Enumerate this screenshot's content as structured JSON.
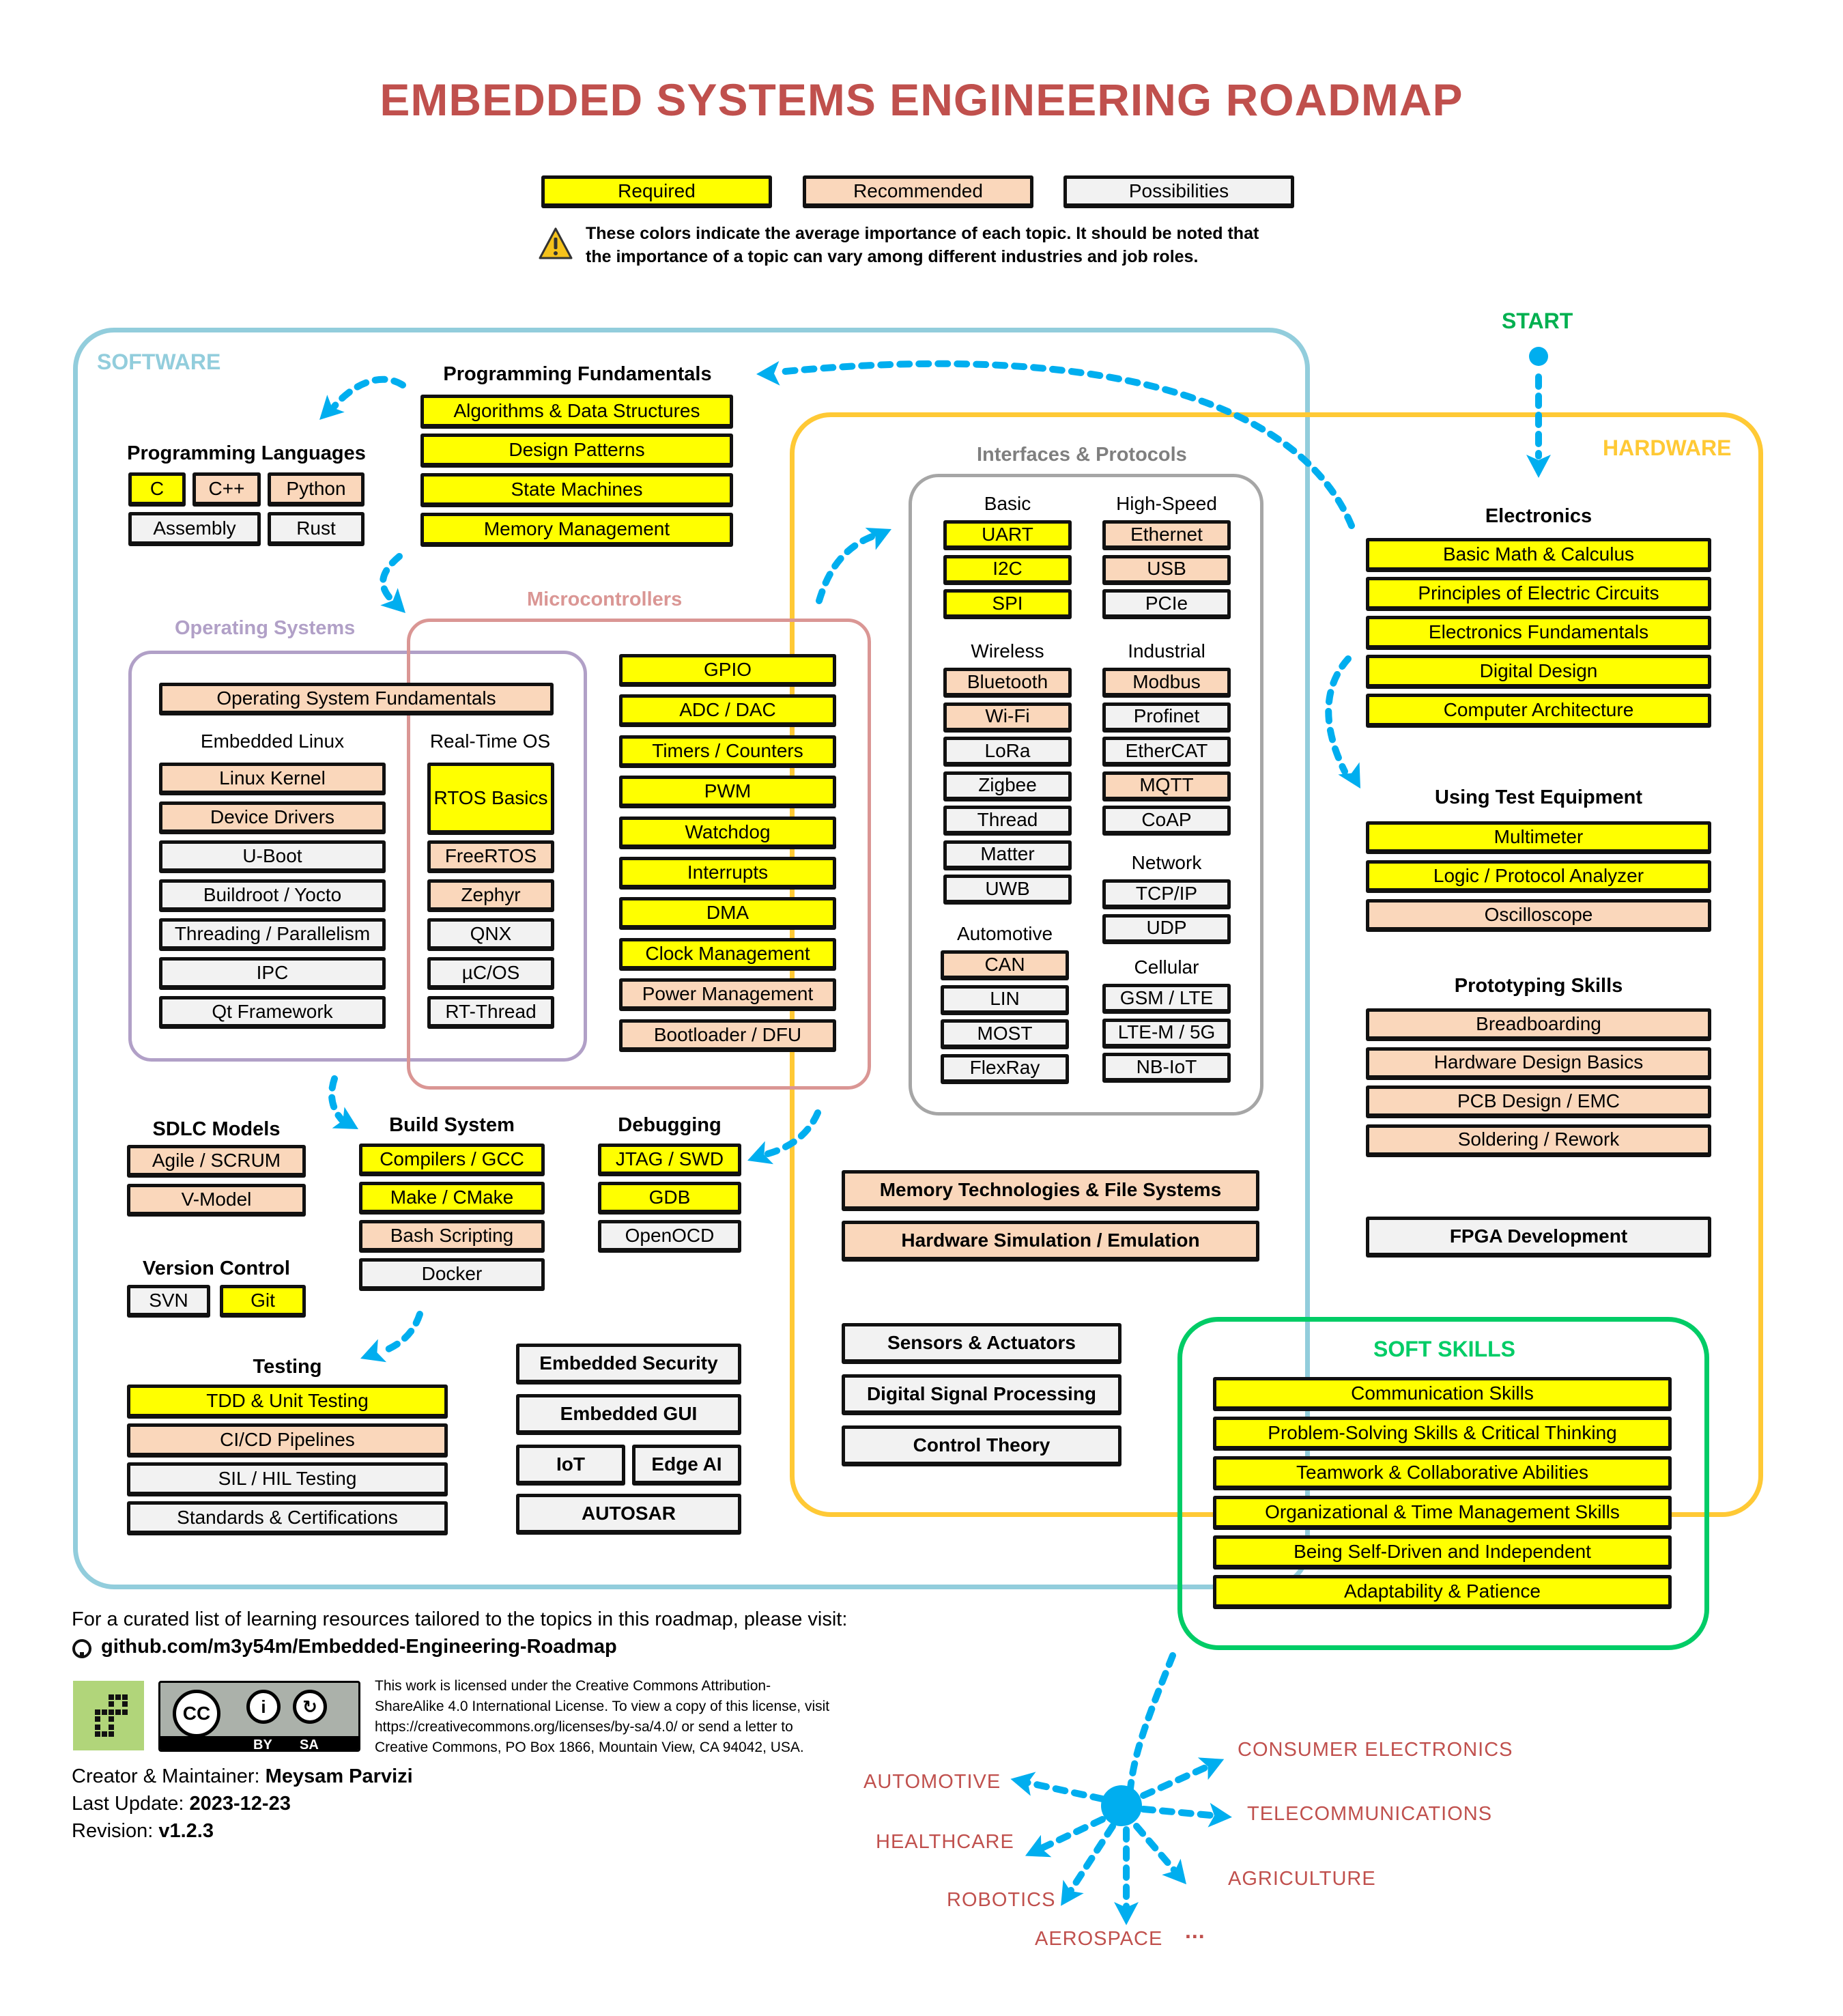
{
  "title": "EMBEDDED SYSTEMS ENGINEERING ROADMAP",
  "legend": {
    "required": "Required",
    "recommended": "Recommended",
    "possibilities": "Possibilities",
    "note_line1": "These colors indicate the average importance of each topic. It should be noted that",
    "note_line2": "the importance of a topic can vary among different industries and job roles.",
    "colors": {
      "required": "#ffff00",
      "recommended": "#fad7bb",
      "possibilities": "#f2f2f2"
    }
  },
  "start_label": "START",
  "containers": {
    "software": {
      "label": "SOFTWARE",
      "color": "#92cddc"
    },
    "hardware": {
      "label": "HARDWARE",
      "color": "#ffc935"
    },
    "soft_skills": {
      "label": "SOFT SKILLS",
      "color": "#00cc66"
    },
    "operating_systems": {
      "label": "Operating Systems",
      "color": "#b1a0c7"
    },
    "microcontrollers": {
      "label": "Microcontrollers",
      "color": "#da9694"
    },
    "interfaces": {
      "label": "Interfaces & Protocols",
      "color": "#a6a6a6"
    }
  },
  "programming_fundamentals": {
    "heading": "Programming Fundamentals",
    "items": [
      {
        "label": "Algorithms & Data Structures",
        "level": "req"
      },
      {
        "label": "Design Patterns",
        "level": "req"
      },
      {
        "label": "State Machines",
        "level": "req"
      },
      {
        "label": "Memory Management",
        "level": "req"
      }
    ]
  },
  "programming_languages": {
    "heading": "Programming Languages",
    "items": [
      {
        "label": "C",
        "level": "req"
      },
      {
        "label": "C++",
        "level": "rec"
      },
      {
        "label": "Python",
        "level": "rec"
      },
      {
        "label": "Assembly",
        "level": "pos"
      },
      {
        "label": "Rust",
        "level": "pos"
      }
    ]
  },
  "operating_systems": {
    "fundamentals": {
      "label": "Operating System Fundamentals",
      "level": "rec"
    },
    "embedded_linux": {
      "heading": "Embedded Linux",
      "items": [
        {
          "label": "Linux Kernel",
          "level": "rec"
        },
        {
          "label": "Device Drivers",
          "level": "rec"
        },
        {
          "label": "U-Boot",
          "level": "pos"
        },
        {
          "label": "Buildroot / Yocto",
          "level": "pos"
        },
        {
          "label": "Threading / Parallelism",
          "level": "pos"
        },
        {
          "label": "IPC",
          "level": "pos"
        },
        {
          "label": "Qt Framework",
          "level": "pos"
        }
      ]
    },
    "rtos": {
      "heading": "Real-Time OS",
      "items": [
        {
          "label": "RTOS Basics",
          "level": "req"
        },
        {
          "label": "FreeRTOS",
          "level": "rec"
        },
        {
          "label": "Zephyr",
          "level": "rec"
        },
        {
          "label": "QNX",
          "level": "pos"
        },
        {
          "label": "µC/OS",
          "level": "pos"
        },
        {
          "label": "RT-Thread",
          "level": "pos"
        }
      ]
    }
  },
  "microcontrollers": {
    "items": [
      {
        "label": "GPIO",
        "level": "req"
      },
      {
        "label": "ADC / DAC",
        "level": "req"
      },
      {
        "label": "Timers / Counters",
        "level": "req"
      },
      {
        "label": "PWM",
        "level": "req"
      },
      {
        "label": "Watchdog",
        "level": "req"
      },
      {
        "label": "Interrupts",
        "level": "req"
      },
      {
        "label": "DMA",
        "level": "req"
      },
      {
        "label": "Clock Management",
        "level": "req"
      },
      {
        "label": "Power Management",
        "level": "rec"
      },
      {
        "label": "Bootloader / DFU",
        "level": "rec"
      }
    ]
  },
  "interfaces": {
    "basic": {
      "heading": "Basic",
      "items": [
        {
          "label": "UART",
          "level": "req"
        },
        {
          "label": "I2C",
          "level": "req"
        },
        {
          "label": "SPI",
          "level": "req"
        }
      ]
    },
    "high_speed": {
      "heading": "High-Speed",
      "items": [
        {
          "label": "Ethernet",
          "level": "rec"
        },
        {
          "label": "USB",
          "level": "rec"
        },
        {
          "label": "PCIe",
          "level": "pos"
        }
      ]
    },
    "wireless": {
      "heading": "Wireless",
      "items": [
        {
          "label": "Bluetooth",
          "level": "rec"
        },
        {
          "label": "Wi-Fi",
          "level": "rec"
        },
        {
          "label": "LoRa",
          "level": "pos"
        },
        {
          "label": "Zigbee",
          "level": "pos"
        },
        {
          "label": "Thread",
          "level": "pos"
        },
        {
          "label": "Matter",
          "level": "pos"
        },
        {
          "label": "UWB",
          "level": "pos"
        }
      ]
    },
    "industrial": {
      "heading": "Industrial",
      "items": [
        {
          "label": "Modbus",
          "level": "rec"
        },
        {
          "label": "Profinet",
          "level": "pos"
        },
        {
          "label": "EtherCAT",
          "level": "pos"
        },
        {
          "label": "MQTT",
          "level": "rec"
        },
        {
          "label": "CoAP",
          "level": "pos"
        }
      ]
    },
    "network": {
      "heading": "Network",
      "items": [
        {
          "label": "TCP/IP",
          "level": "pos"
        },
        {
          "label": "UDP",
          "level": "pos"
        }
      ]
    },
    "automotive": {
      "heading": "Automotive",
      "items": [
        {
          "label": "CAN",
          "level": "rec"
        },
        {
          "label": "LIN",
          "level": "pos"
        },
        {
          "label": "MOST",
          "level": "pos"
        },
        {
          "label": "FlexRay",
          "level": "pos"
        }
      ]
    },
    "cellular": {
      "heading": "Cellular",
      "items": [
        {
          "label": "GSM / LTE",
          "level": "pos"
        },
        {
          "label": "LTE-M / 5G",
          "level": "pos"
        },
        {
          "label": "NB-IoT",
          "level": "pos"
        }
      ]
    }
  },
  "sdlc": {
    "heading": "SDLC Models",
    "items": [
      {
        "label": "Agile / SCRUM",
        "level": "rec"
      },
      {
        "label": "V-Model",
        "level": "rec"
      }
    ]
  },
  "version_control": {
    "heading": "Version Control",
    "items": [
      {
        "label": "SVN",
        "level": "pos"
      },
      {
        "label": "Git",
        "level": "req"
      }
    ]
  },
  "build_system": {
    "heading": "Build System",
    "items": [
      {
        "label": "Compilers / GCC",
        "level": "req"
      },
      {
        "label": "Make / CMake",
        "level": "req"
      },
      {
        "label": "Bash Scripting",
        "level": "rec"
      },
      {
        "label": "Docker",
        "level": "pos"
      }
    ]
  },
  "debugging": {
    "heading": "Debugging",
    "items": [
      {
        "label": "JTAG / SWD",
        "level": "req"
      },
      {
        "label": "GDB",
        "level": "req"
      },
      {
        "label": "OpenOCD",
        "level": "pos"
      }
    ]
  },
  "testing": {
    "heading": "Testing",
    "items": [
      {
        "label": "TDD & Unit Testing",
        "level": "req"
      },
      {
        "label": "CI/CD Pipelines",
        "level": "rec"
      },
      {
        "label": "SIL / HIL Testing",
        "level": "pos"
      },
      {
        "label": "Standards & Certifications",
        "level": "pos"
      }
    ]
  },
  "software_extras": [
    {
      "label": "Embedded Security",
      "level": "pos"
    },
    {
      "label": "Embedded GUI",
      "level": "pos"
    },
    {
      "label": "IoT",
      "level": "pos"
    },
    {
      "label": "Edge AI",
      "level": "pos"
    },
    {
      "label": "AUTOSAR",
      "level": "pos"
    }
  ],
  "shared_topics": [
    {
      "label": "Memory Technologies & File Systems",
      "level": "rec"
    },
    {
      "label": "Hardware Simulation / Emulation",
      "level": "rec"
    },
    {
      "label": "Sensors & Actuators",
      "level": "pos"
    },
    {
      "label": "Digital Signal Processing",
      "level": "pos"
    },
    {
      "label": "Control Theory",
      "level": "pos"
    }
  ],
  "electronics": {
    "heading": "Electronics",
    "items": [
      {
        "label": "Basic Math & Calculus",
        "level": "req"
      },
      {
        "label": "Principles of Electric Circuits",
        "level": "req"
      },
      {
        "label": "Electronics Fundamentals",
        "level": "req"
      },
      {
        "label": "Digital Design",
        "level": "req"
      },
      {
        "label": "Computer Architecture",
        "level": "req"
      }
    ]
  },
  "test_equipment": {
    "heading": "Using Test Equipment",
    "items": [
      {
        "label": "Multimeter",
        "level": "req"
      },
      {
        "label": "Logic / Protocol Analyzer",
        "level": "req"
      },
      {
        "label": "Oscilloscope",
        "level": "rec"
      }
    ]
  },
  "prototyping": {
    "heading": "Prototyping Skills",
    "items": [
      {
        "label": "Breadboarding",
        "level": "rec"
      },
      {
        "label": "Hardware Design Basics",
        "level": "rec"
      },
      {
        "label": "PCB Design / EMC",
        "level": "rec"
      },
      {
        "label": "Soldering / Rework",
        "level": "rec"
      }
    ]
  },
  "fpga": {
    "label": "FPGA Development",
    "level": "pos"
  },
  "soft_skills": {
    "items": [
      {
        "label": "Communication Skills",
        "level": "req"
      },
      {
        "label": "Problem-Solving Skills & Critical Thinking",
        "level": "req"
      },
      {
        "label": "Teamwork & Collaborative Abilities",
        "level": "req"
      },
      {
        "label": "Organizational & Time Management Skills",
        "level": "req"
      },
      {
        "label": "Being Self-Driven and Independent",
        "level": "req"
      },
      {
        "label": "Adaptability & Patience",
        "level": "req"
      }
    ]
  },
  "industries": [
    "AUTOMOTIVE",
    "HEALTHCARE",
    "ROBOTICS",
    "AEROSPACE",
    "...",
    "AGRICULTURE",
    "TELECOMMUNICATIONS",
    "CONSUMER ELECTRONICS"
  ],
  "footer": {
    "resources_text": "For a curated list of learning resources tailored to the topics in this roadmap, please visit:",
    "github_link": "github.com/m3y54m/Embedded-Engineering-Roadmap",
    "license_text": [
      "This work is licensed under the Creative Commons Attribution-",
      "ShareAlike 4.0 International License. To view a copy of this license, visit",
      "https://creativecommons.org/licenses/by-sa/4.0/ or send a letter to",
      "Creative Commons, PO Box 1866, Mountain View, CA 94042, USA."
    ],
    "cc_badge": {
      "cc": "CC",
      "by": "BY",
      "sa": "SA"
    },
    "creator_label": "Creator & Maintainer: ",
    "creator_name": "Meysam Parvizi",
    "update_label": "Last Update: ",
    "update_value": "2023-12-23",
    "revision_label": "Revision: ",
    "revision_value": "v1.2.3"
  }
}
